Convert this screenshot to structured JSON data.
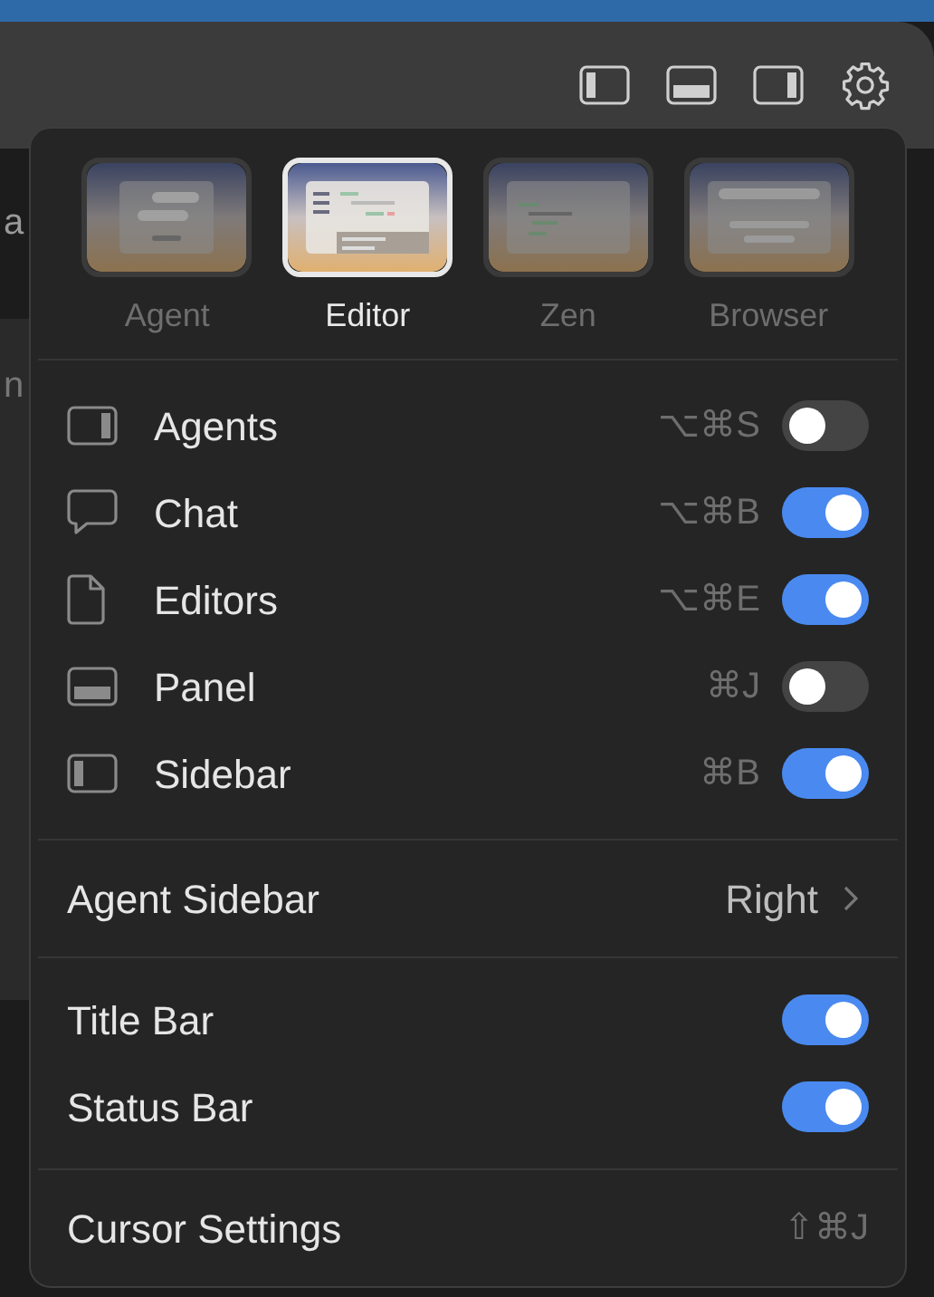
{
  "titlebar": {
    "icons": [
      {
        "kind": "sidebar-left"
      },
      {
        "kind": "panel"
      },
      {
        "kind": "sidebar-right"
      },
      {
        "kind": "settings"
      }
    ]
  },
  "background_text": [
    "a",
    "n"
  ],
  "menu": {
    "layouts": [
      {
        "label": "Agent",
        "kind": "agent",
        "selected": false
      },
      {
        "label": "Editor",
        "kind": "editor",
        "selected": true
      },
      {
        "label": "Zen",
        "kind": "zen",
        "selected": false
      },
      {
        "label": "Browser",
        "kind": "browser",
        "selected": false
      }
    ],
    "toggles": [
      {
        "kind": "sidebar-right",
        "label": "Agents",
        "shortcut": "⌥⌘S",
        "on": false
      },
      {
        "kind": "chat",
        "label": "Chat",
        "shortcut": "⌥⌘B",
        "on": true
      },
      {
        "kind": "file",
        "label": "Editors",
        "shortcut": "⌥⌘E",
        "on": true
      },
      {
        "kind": "panel",
        "label": "Panel",
        "shortcut": "⌘J",
        "on": false
      },
      {
        "kind": "sidebar-left",
        "label": "Sidebar",
        "shortcut": "⌘B",
        "on": true
      }
    ],
    "agent_sidebar": {
      "label": "Agent Sidebar",
      "value": "Right"
    },
    "bars": [
      {
        "label": "Title Bar",
        "on": true
      },
      {
        "label": "Status Bar",
        "on": true
      }
    ],
    "settings": {
      "label": "Cursor Settings",
      "shortcut": "⇧⌘J"
    }
  }
}
